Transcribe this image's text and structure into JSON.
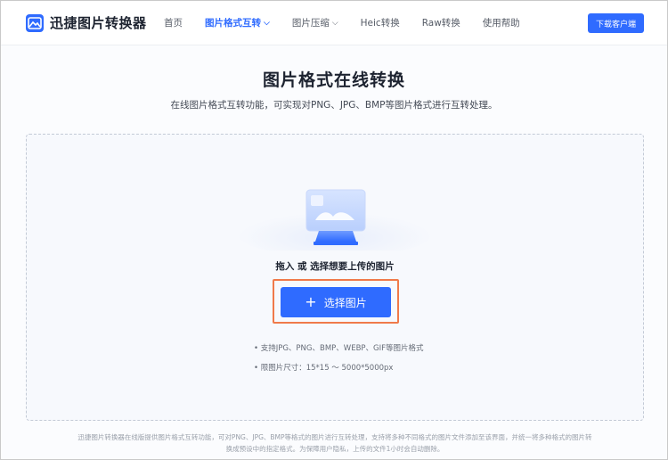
{
  "header": {
    "app_name": "迅捷图片转换器",
    "nav": [
      {
        "label": "首页",
        "active": false,
        "dropdown": false
      },
      {
        "label": "图片格式互转",
        "active": true,
        "dropdown": true
      },
      {
        "label": "图片压缩",
        "active": false,
        "dropdown": true
      },
      {
        "label": "Heic转换",
        "active": false,
        "dropdown": false
      },
      {
        "label": "Raw转换",
        "active": false,
        "dropdown": false
      },
      {
        "label": "使用帮助",
        "active": false,
        "dropdown": false
      }
    ],
    "download_label": "下载客户端"
  },
  "main": {
    "title": "图片格式在线转换",
    "subtitle": "在线图片格式互转功能，可实现对PNG、JPG、BMP等图片格式进行互转处理。"
  },
  "upload": {
    "drop_text": "拖入 或 选择想要上传的图片",
    "select_label": "选择图片",
    "tips": [
      "• 支持JPG、PNG、BMP、WEBP、GIF等图片格式",
      "• 限图片尺寸：15*15 ～ 5000*5000px"
    ]
  },
  "footer": {
    "line1": "迅捷图片转换器在线版提供图片格式互转功能，可对PNG、JPG、BMP等格式的图片进行互转处理，支持将多种不同格式的图片文件添加至该界面，并统一将多种格式的图片转",
    "line2": "换成预设中的指定格式。为保障用户隐私，上传的文件1小时会自动删除。"
  },
  "colors": {
    "accent": "#2f6bff",
    "highlight": "#f07a4a"
  }
}
